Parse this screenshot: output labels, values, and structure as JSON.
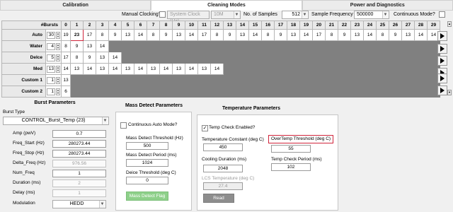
{
  "tabs": [
    "Calibration",
    "Cleaning Modes",
    "Power and Diagnostics"
  ],
  "top_controls": {
    "manual_clocking_label": "Manual Clocking?",
    "system_clock_label": "System Clock (Hz)",
    "system_clock_value": "10M",
    "num_samples_label": "No. of Samples",
    "num_samples_value": "512",
    "sample_freq_label": "Sample Frequency",
    "sample_freq_value": "500000",
    "continuous_mode_label": "Continuous Mode?"
  },
  "grid": {
    "header_label": "#Bursts",
    "columns": [
      "0",
      "1",
      "2",
      "3",
      "4",
      "5",
      "6",
      "7",
      "8",
      "9",
      "10",
      "11",
      "12",
      "13",
      "14",
      "15",
      "16",
      "17",
      "18",
      "19",
      "20",
      "21",
      "22",
      "23",
      "24",
      "25",
      "26",
      "27",
      "28",
      "29"
    ],
    "rows": [
      {
        "label": "Auto",
        "count": "30",
        "cells": [
          "19",
          "23",
          "17",
          "8",
          "9",
          "13",
          "14",
          "8",
          "9",
          "13",
          "14",
          "17",
          "8",
          "9",
          "13",
          "14",
          "8",
          "9",
          "13",
          "14",
          "17",
          "8",
          "9",
          "13",
          "14",
          "8",
          "9",
          "13",
          "14",
          "14"
        ]
      },
      {
        "label": "Water",
        "count": "4",
        "cells": [
          "8",
          "9",
          "13",
          "14"
        ]
      },
      {
        "label": "Delce",
        "count": "5",
        "cells": [
          "17",
          "8",
          "9",
          "13",
          "14"
        ]
      },
      {
        "label": "Med",
        "count": "13",
        "cells": [
          "14",
          "13",
          "14",
          "13",
          "14",
          "13",
          "14",
          "13",
          "14",
          "13",
          "14",
          "13",
          "14"
        ]
      },
      {
        "label": "Custom 1",
        "count": "1",
        "cells": [
          "13"
        ]
      },
      {
        "label": "Custom 2",
        "count": "1",
        "cells": [
          "6"
        ]
      }
    ]
  },
  "burst": {
    "title": "Burst Parameters",
    "type_label": "Burst Type",
    "type_value": "CONTROL_Burst_Temp (23)",
    "fields": [
      {
        "label": "Amp (pwV)",
        "value": "0.7",
        "disabled": false
      },
      {
        "label": "Freq_Start (Hz)",
        "value": "280273.44",
        "disabled": false
      },
      {
        "label": "Freq_Stop (Hz)",
        "value": "280273.44",
        "disabled": false
      },
      {
        "label": "Delta_Freq (Hz)",
        "value": "976.56",
        "disabled": true
      },
      {
        "label": "Num_Freq",
        "value": "1",
        "disabled": false
      },
      {
        "label": "Duration (ms)",
        "value": "2",
        "disabled": true
      },
      {
        "label": "Delay (ms)",
        "value": "1",
        "disabled": true
      }
    ],
    "modulation_label": "Modulation",
    "modulation_value": "HEDD"
  },
  "mass": {
    "title": "Mass Detect Parameters",
    "continuous_label": "Continuous Auto Mode?",
    "threshold_label": "Mass Detect Threshold (Hz)",
    "threshold_value": "500",
    "period_label": "Mass Detect Period (ms)",
    "period_value": "1024",
    "deice_label": "Deice Threshold (deg C)",
    "deice_value": "0",
    "flag_label": "Mass Detect Flag"
  },
  "temp": {
    "title": "Temperature Parameters",
    "enabled_label": "Temp Check Enabled?",
    "constant_label": "Temperature Constant (deg C)",
    "constant_value": "450",
    "overtemp_label": "OverTemp Threshold (deg C)",
    "overtemp_value": "55",
    "cooling_label": "Cooling Duration (ms)",
    "cooling_value": "2048",
    "check_period_label": "Temp Check Period (ms)",
    "check_period_value": "102",
    "lcs_label": "LCS Temperature (deg C)",
    "lcs_value": "27.4",
    "read_label": "Read"
  }
}
